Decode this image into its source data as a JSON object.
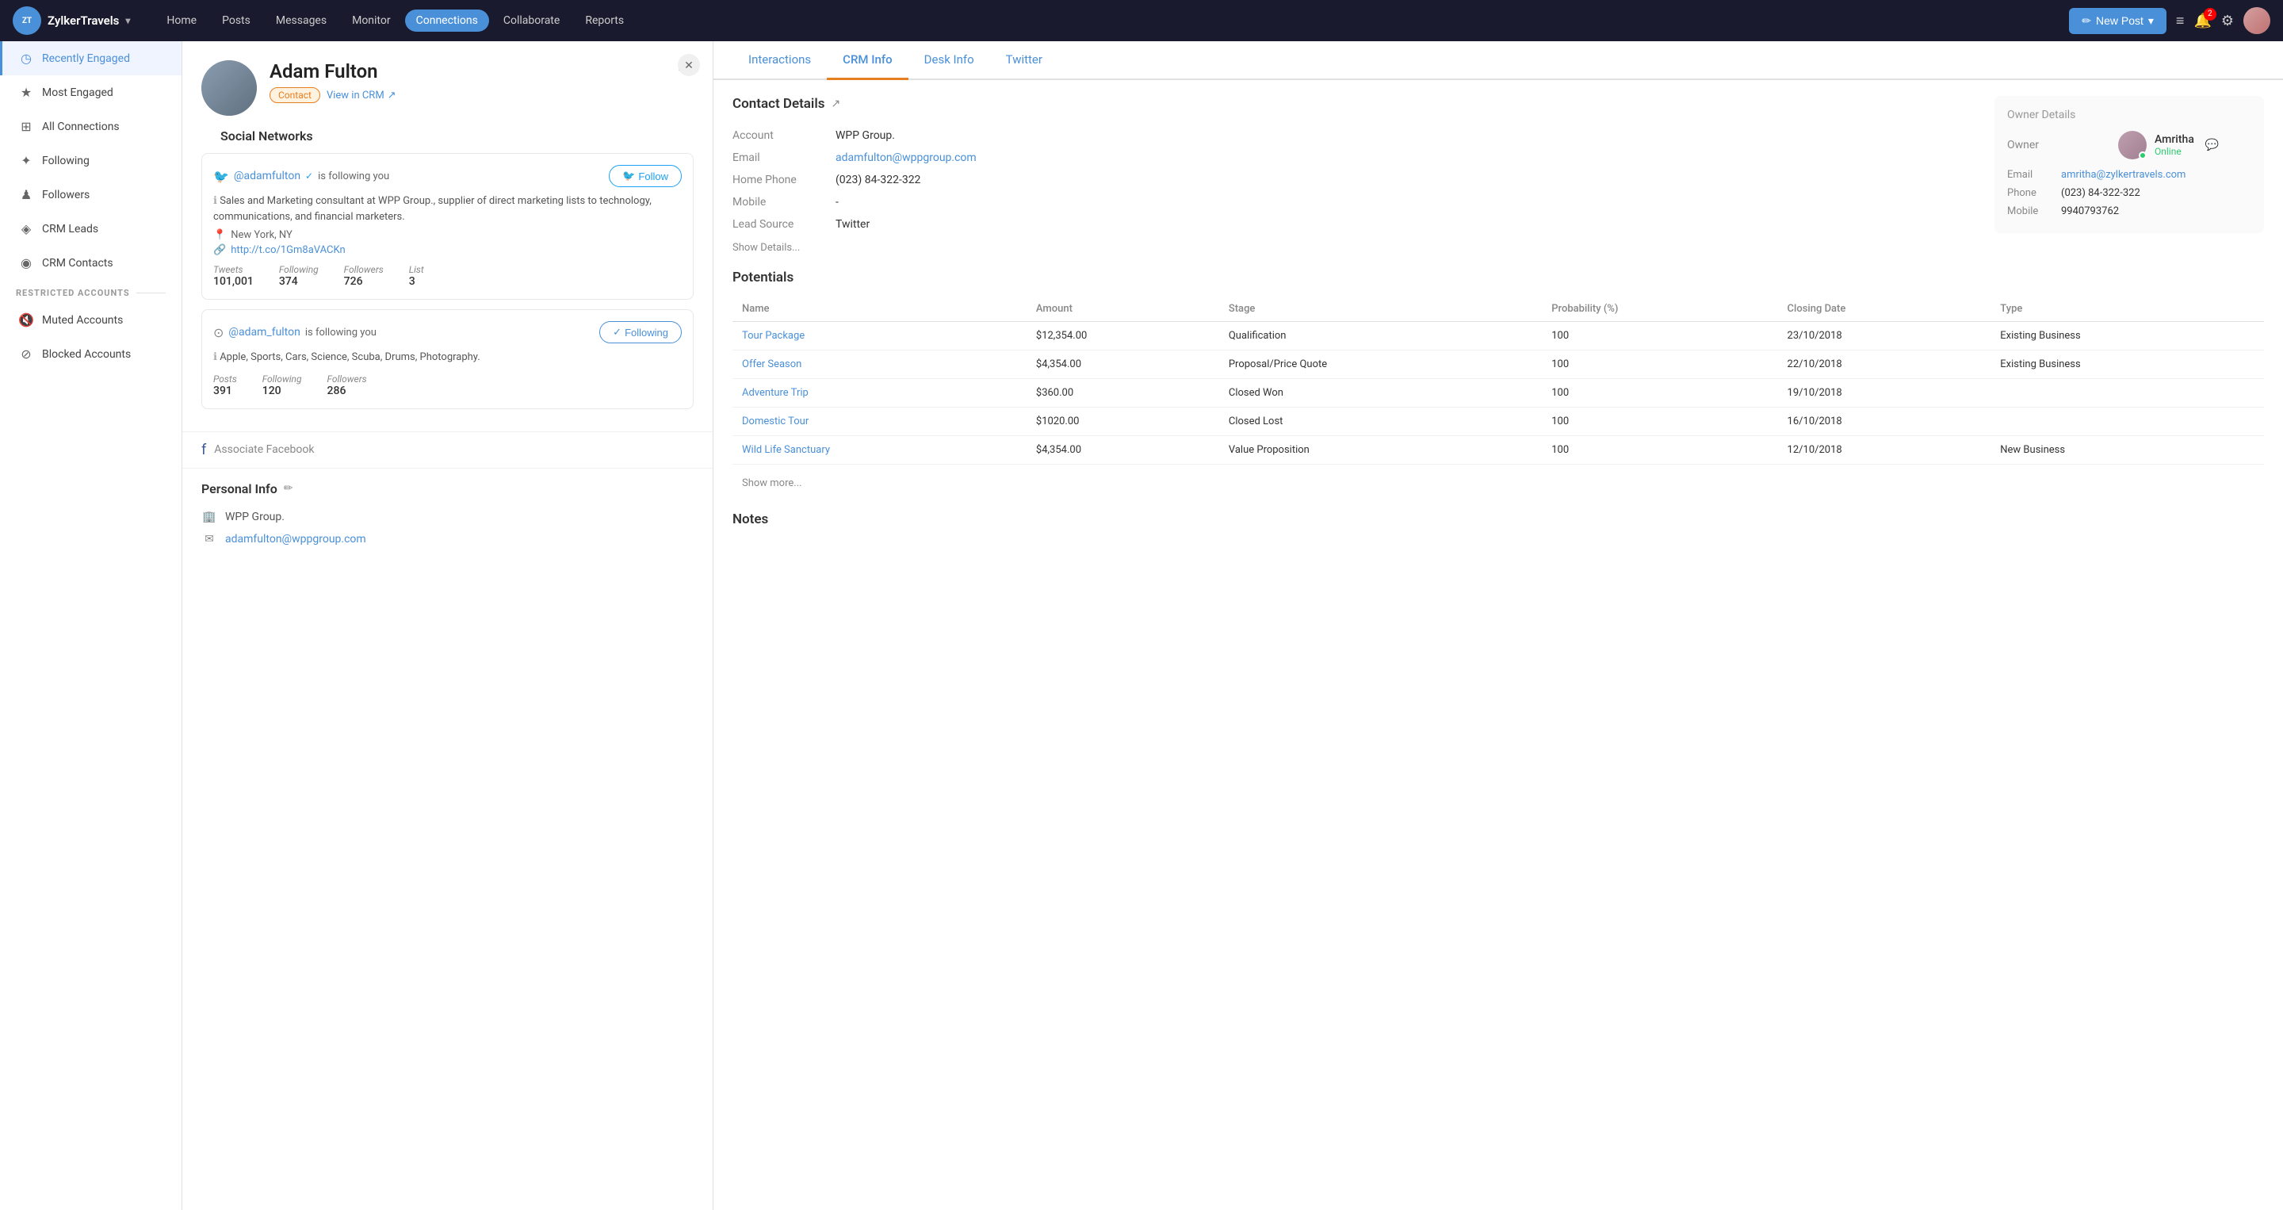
{
  "brand": {
    "logo_text": "ZT",
    "name": "ZylkerTravels",
    "chevron": "▾"
  },
  "nav": {
    "items": [
      {
        "id": "home",
        "label": "Home",
        "active": false
      },
      {
        "id": "posts",
        "label": "Posts",
        "active": false
      },
      {
        "id": "messages",
        "label": "Messages",
        "active": false
      },
      {
        "id": "monitor",
        "label": "Monitor",
        "active": false
      },
      {
        "id": "connections",
        "label": "Connections",
        "active": true
      },
      {
        "id": "collaborate",
        "label": "Collaborate",
        "active": false
      },
      {
        "id": "reports",
        "label": "Reports",
        "active": false
      }
    ],
    "new_post_label": "New Post",
    "notification_count": "2"
  },
  "sidebar": {
    "items": [
      {
        "id": "recently-engaged",
        "label": "Recently Engaged",
        "icon": "◷",
        "active": true
      },
      {
        "id": "most-engaged",
        "label": "Most Engaged",
        "icon": "★",
        "active": false
      },
      {
        "id": "all-connections",
        "label": "All Connections",
        "icon": "⊞",
        "active": false
      },
      {
        "id": "following",
        "label": "Following",
        "icon": "✦",
        "active": false
      },
      {
        "id": "followers",
        "label": "Followers",
        "icon": "♟",
        "active": false
      },
      {
        "id": "crm-leads",
        "label": "CRM Leads",
        "icon": "◈",
        "active": false
      },
      {
        "id": "crm-contacts",
        "label": "CRM Contacts",
        "icon": "◉",
        "active": false
      }
    ],
    "restricted_label": "RESTRICTED ACCOUNTS",
    "restricted_items": [
      {
        "id": "muted-accounts",
        "label": "Muted Accounts",
        "icon": "🔇"
      },
      {
        "id": "blocked-accounts",
        "label": "Blocked Accounts",
        "icon": "⊘"
      }
    ]
  },
  "profile": {
    "name": "Adam Fulton",
    "tag": "Contact",
    "view_crm_label": "View in CRM",
    "more_icon": "•••",
    "close_icon": "✕",
    "social_networks_title": "Social Networks",
    "twitter": {
      "handle": "@adamfulton",
      "verified": true,
      "following_you": "is following you",
      "follow_label": "Follow",
      "bio": "Sales and Marketing consultant at WPP Group., supplier of direct marketing lists to technology, communications, and financial marketers.",
      "location": "New York, NY",
      "link": "http://t.co/1Gm8aVACKn",
      "stats": [
        {
          "label": "Tweets",
          "value": "101,001"
        },
        {
          "label": "Following",
          "value": "374"
        },
        {
          "label": "Followers",
          "value": "726"
        },
        {
          "label": "List",
          "value": "3"
        }
      ]
    },
    "instagram": {
      "handle": "@adam_fulton",
      "following_you": "is following you",
      "following_label": "Following",
      "bio": "Apple, Sports, Cars, Science, Scuba, Drums, Photography.",
      "stats": [
        {
          "label": "Posts",
          "value": "391"
        },
        {
          "label": "Following",
          "value": "120"
        },
        {
          "label": "Followers",
          "value": "286"
        }
      ]
    },
    "associate_facebook": "Associate Facebook",
    "personal_info_title": "Personal Info",
    "personal_info": {
      "company": "WPP Group.",
      "email": "adamfulton@wppgroup.com"
    }
  },
  "crm": {
    "tabs": [
      {
        "id": "interactions",
        "label": "Interactions",
        "active": false
      },
      {
        "id": "crm-info",
        "label": "CRM Info",
        "active": true
      },
      {
        "id": "desk-info",
        "label": "Desk Info",
        "active": false
      },
      {
        "id": "twitter",
        "label": "Twitter",
        "active": false
      }
    ],
    "contact_details_title": "Contact Details",
    "contact": {
      "account_label": "Account",
      "account_value": "WPP Group.",
      "email_label": "Email",
      "email_value": "adamfulton@wppgroup.com",
      "home_phone_label": "Home Phone",
      "home_phone_value": "(023) 84-322-322",
      "mobile_label": "Mobile",
      "mobile_value": "-",
      "lead_source_label": "Lead Source",
      "lead_source_value": "Twitter",
      "show_details_label": "Show Details..."
    },
    "owner_details_title": "Owner Details",
    "owner": {
      "owner_label": "Owner",
      "owner_name": "Amritha",
      "online_label": "Online",
      "email_label": "Email",
      "email_value": "amritha@zylkertravels.com",
      "phone_label": "Phone",
      "phone_value": "(023) 84-322-322",
      "mobile_label": "Mobile",
      "mobile_value": "9940793762"
    },
    "potentials_title": "Potentials",
    "potentials_headers": [
      "Name",
      "Amount",
      "Stage",
      "Probability (%)",
      "Closing Date",
      "Type"
    ],
    "potentials_rows": [
      {
        "name": "Tour Package",
        "amount": "$12,354.00",
        "stage": "Qualification",
        "probability": "100",
        "closing_date": "23/10/2018",
        "type": "Existing Business"
      },
      {
        "name": "Offer Season",
        "amount": "$4,354.00",
        "stage": "Proposal/Price Quote",
        "probability": "100",
        "closing_date": "22/10/2018",
        "type": "Existing Business"
      },
      {
        "name": "Adventure Trip",
        "amount": "$360.00",
        "stage": "Closed Won",
        "probability": "100",
        "closing_date": "19/10/2018",
        "type": ""
      },
      {
        "name": "Domestic Tour",
        "amount": "$1020.00",
        "stage": "Closed Lost",
        "probability": "100",
        "closing_date": "16/10/2018",
        "type": ""
      },
      {
        "name": "Wild Life Sanctuary",
        "amount": "$4,354.00",
        "stage": "Value Proposition",
        "probability": "100",
        "closing_date": "12/10/2018",
        "type": "New Business"
      }
    ],
    "show_more_label": "Show more...",
    "notes_title": "Notes"
  }
}
